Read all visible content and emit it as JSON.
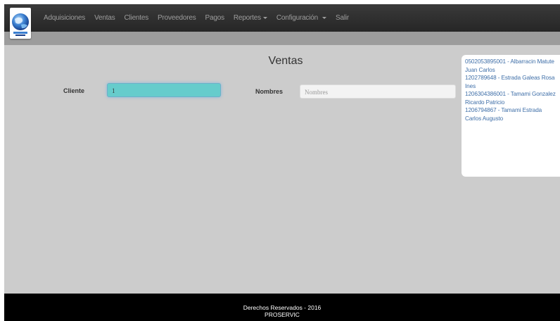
{
  "nav": {
    "items": [
      {
        "label": "Adquisiciones",
        "dropdown": false
      },
      {
        "label": "Ventas",
        "dropdown": false
      },
      {
        "label": "Clientes",
        "dropdown": false
      },
      {
        "label": "Proveedores",
        "dropdown": false
      },
      {
        "label": "Pagos",
        "dropdown": false
      },
      {
        "label": "Reportes",
        "dropdown": true
      },
      {
        "label": "Configuración",
        "dropdown": true
      },
      {
        "label": "Salir",
        "dropdown": false
      }
    ]
  },
  "page": {
    "title": "Ventas"
  },
  "form": {
    "cliente_label": "Cliente",
    "cliente_value": "1",
    "nombres_label": "Nombres",
    "nombres_placeholder": "Nombres"
  },
  "suggestions": [
    "0502053895001 - Albarracin Matute\nJuan Carlos",
    "1202789648 - Estrada Galeas Rosa\nInes",
    "1206304386001 - Tamami Gonzalez\nRicardo Patricio",
    "1206794867 - Tamami Estrada\nCarlos Augusto"
  ],
  "footer": {
    "line1": "Derechos Reservados - 2016",
    "line2": "PROSERVIC"
  },
  "colors": {
    "navbar": "#262626",
    "page_bg": "#cccccc",
    "focus_input": "#66cccc",
    "link": "#3f6fa8"
  }
}
